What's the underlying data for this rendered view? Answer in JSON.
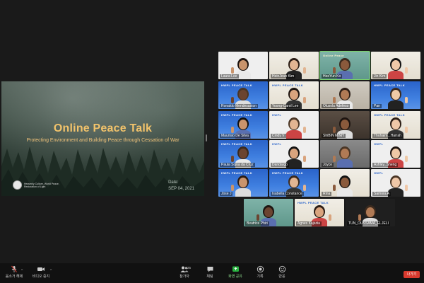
{
  "slide": {
    "title": "Online Peace Talk",
    "subtitle": "Protecting Environment and Building Peace through Cessation of War",
    "org": "Heavenly Culture, World Peace, Restoration of Light",
    "date_label": "Date:",
    "date_value": "SEP 04, 2021"
  },
  "gallery": {
    "tiles": [
      {
        "name": "Laura Lee",
        "brand": "",
        "bg": "white"
      },
      {
        "name": "HeinJeun Kim",
        "brand": "",
        "bg": "cream"
      },
      {
        "name": "HeeYun Ko",
        "brand": "Online Peace",
        "bg": "teal"
      },
      {
        "name": "Jin Kim",
        "brand": "",
        "bg": "cream"
      },
      {
        "name": "Ronaldo Mendesaston",
        "brand": "HWPL  PEACE TALK",
        "bg": "hwpl"
      },
      {
        "name": "Yoong-Carol Lee",
        "brand": "HWPL PEACE TALK",
        "bg": "cream"
      },
      {
        "name": "Olusola Adefeso",
        "brand": "",
        "bg": "room"
      },
      {
        "name": "Pan",
        "brand": "HWPL  PEACE TALK",
        "bg": "hwpl"
      },
      {
        "name": "Maurisio De Silva",
        "brand": "HWPL  PEACE TALK",
        "bg": "hwpl"
      },
      {
        "name": "Cindy V",
        "brand": "HWPL",
        "bg": "white"
      },
      {
        "name": "ShiBIN MINH",
        "brand": "",
        "bg": "dark"
      },
      {
        "name": "Thohaim...Harrah",
        "brand": "HWPL PEACE TALK",
        "bg": "cream"
      },
      {
        "name": "Paula Sojka da Cruz",
        "brand": "HWPL  PEACE TALK",
        "bg": "hwpl"
      },
      {
        "name": "Dandargo",
        "brand": "HWPL",
        "bg": "white"
      },
      {
        "name": "Joyce",
        "brand": "",
        "bg": "grey"
      },
      {
        "name": "Ashley_Sheng",
        "brand": "HWPL",
        "bg": "white"
      },
      {
        "name": "Jose J",
        "brand": "HWPL  PEACE TALK",
        "bg": "hwpl"
      },
      {
        "name": "Isabella Constance",
        "brand": "HWPL  PEACE TALK",
        "bg": "hwpl"
      },
      {
        "name": "Rina",
        "brand": "",
        "bg": "cream"
      },
      {
        "name": "Samora A",
        "brand": "HWPL",
        "bg": "white"
      },
      {
        "name": "Beatrice Phiri",
        "brand": "",
        "bg": "teal"
      },
      {
        "name": "Agnes Kajiutia",
        "brand": "HWPL  PEACE TALK",
        "bg": "cream"
      },
      {
        "name": "TUN_OUSSAMA_ELJELI",
        "brand": "",
        "bg": "night"
      }
    ]
  },
  "toolbar": {
    "mute": "음소거 해제",
    "video": "비디오 중지",
    "participants": "참가자",
    "participants_count": "25",
    "chat": "채팅",
    "share": "화면 공유",
    "record": "기록",
    "reactions": "반응",
    "leave": "나가기"
  },
  "colors": {
    "hwpl_blue": "#2a63c9",
    "accent_gold": "#f2c36b",
    "leave_red": "#d93a2e",
    "active_green": "#7bd36a"
  }
}
